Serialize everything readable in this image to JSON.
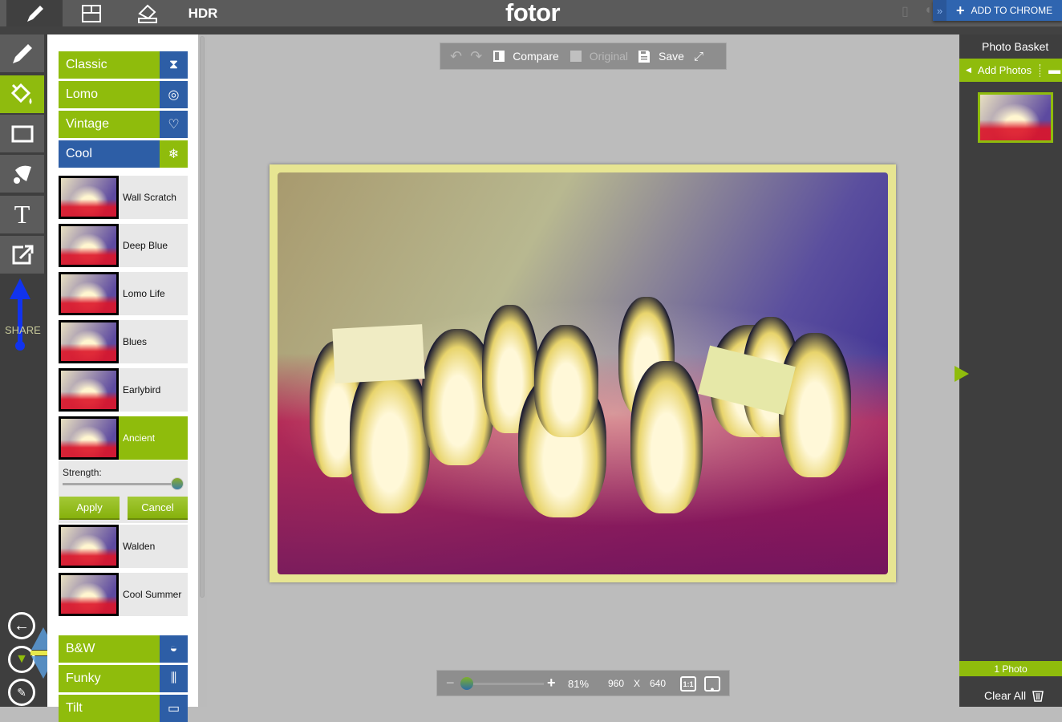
{
  "app": {
    "logo": "fotor"
  },
  "topbar": {
    "tabs": [
      {
        "name": "edit",
        "icon": "pencil-icon",
        "active": true
      },
      {
        "name": "collage",
        "icon": "collage-icon",
        "active": false
      },
      {
        "name": "design",
        "icon": "design-icon",
        "active": false
      },
      {
        "name": "hdr",
        "label": "HDR",
        "active": false
      }
    ],
    "add_to_chrome": "ADD TO CHROME",
    "device_icons": [
      "apple-phone-icon",
      "android-icon"
    ]
  },
  "left_tools": {
    "items": [
      {
        "name": "basic",
        "icon": "pencil-icon",
        "active": false
      },
      {
        "name": "effects",
        "icon": "paint-bucket-icon",
        "active": true
      },
      {
        "name": "frames",
        "icon": "frame-icon",
        "active": false
      },
      {
        "name": "stickers",
        "icon": "bell-icon",
        "active": false
      },
      {
        "name": "text",
        "icon": "text-icon",
        "label": "T",
        "active": false
      },
      {
        "name": "export",
        "icon": "export-icon",
        "active": false
      }
    ],
    "share_label": "SHARE",
    "bottom_buttons": [
      "back-icon",
      "tshirt-icon",
      "edit-note-icon"
    ]
  },
  "effects_panel": {
    "categories_top": [
      {
        "label": "Classic",
        "icon": "hourglass-icon",
        "active": false
      },
      {
        "label": "Lomo",
        "icon": "lomo-icon",
        "active": false
      },
      {
        "label": "Vintage",
        "icon": "heart-icon",
        "active": false
      },
      {
        "label": "Cool",
        "icon": "snowflake-icon",
        "active": true
      }
    ],
    "filters": [
      {
        "label": "Wall Scratch",
        "active": false
      },
      {
        "label": "Deep Blue",
        "active": false
      },
      {
        "label": "Lomo Life",
        "active": false
      },
      {
        "label": "Blues",
        "active": false
      },
      {
        "label": "Earlybird",
        "active": false
      },
      {
        "label": "Ancient",
        "active": true
      },
      {
        "label": "Walden",
        "active": false
      },
      {
        "label": "Cool Summer",
        "active": false
      }
    ],
    "strength": {
      "label": "Strength:",
      "value": 100
    },
    "apply_label": "Apply",
    "cancel_label": "Cancel",
    "categories_bottom": [
      {
        "label": "B&W",
        "icon": "bw-icon"
      },
      {
        "label": "Funky",
        "icon": "column-icon"
      },
      {
        "label": "Tilt",
        "icon": "tilt-icon"
      }
    ]
  },
  "canvas_toolbar": {
    "undo": "undo-icon",
    "redo": "redo-icon",
    "compare_label": "Compare",
    "original_label": "Original",
    "save_label": "Save",
    "fullscreen": "fullscreen-icon"
  },
  "zoom_bar": {
    "zoom_percent": "81%",
    "zoom_value": 0.81,
    "width": "960",
    "times": "X",
    "height": "640",
    "actual_size_label": "1:1"
  },
  "photo_basket": {
    "title": "Photo Basket",
    "add_photos_label": "Add Photos",
    "photo_count": "1 Photo",
    "clear_all_label": "Clear All"
  },
  "colors": {
    "accent_green": "#8fbc0c",
    "accent_blue": "#2d5ea6",
    "dark_bg": "#3e3e3e"
  }
}
